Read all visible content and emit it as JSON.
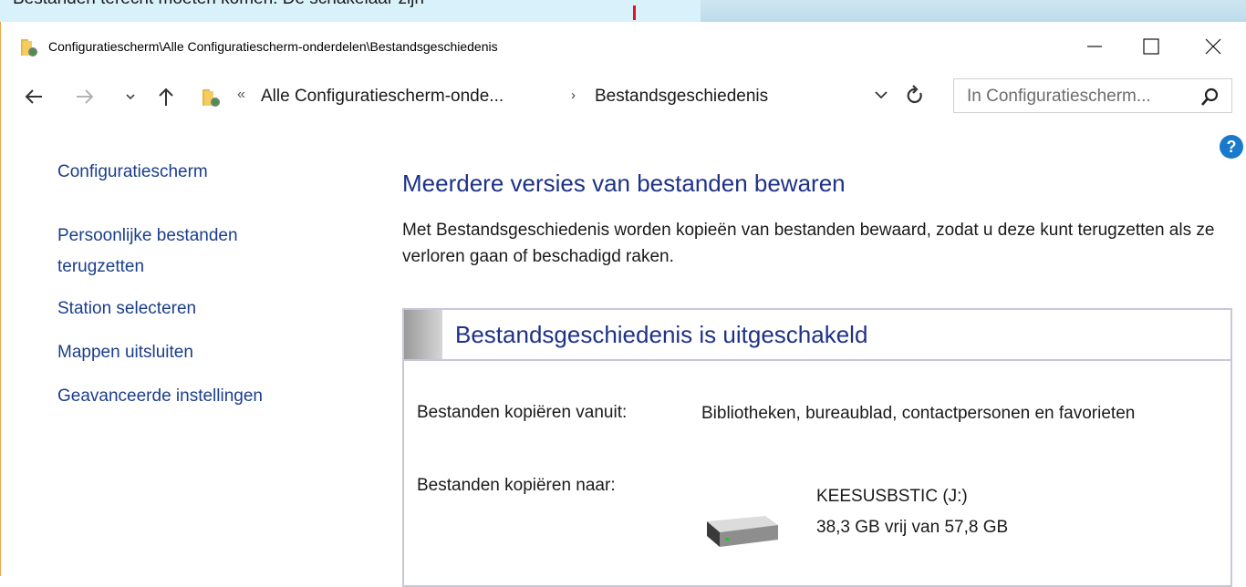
{
  "background": {
    "partial_text": "Bestanden terecht moeten komen. De schakelaar zijn"
  },
  "window": {
    "title": "Configuratiescherm\\Alle Configuratiescherm-onderdelen\\Bestandsgeschiedenis",
    "controls": {
      "minimize_icon": "minimize-icon",
      "maximize_icon": "maximize-icon",
      "close_icon": "close-icon"
    }
  },
  "navigation": {
    "back_icon": "back-arrow-icon",
    "forward_icon": "forward-arrow-icon",
    "recent_icon": "chevron-down-icon",
    "up_icon": "up-arrow-icon",
    "address": {
      "overflow_chevron": "«",
      "crumbs": [
        "Alle Configuratiescherm-onde...",
        "Bestandsgeschiedenis"
      ],
      "separator": "›"
    },
    "search_placeholder": "In Configuratiescherm..."
  },
  "help_label": "?",
  "sidebar": {
    "items": [
      {
        "label": "Configuratiescherm"
      },
      {
        "label": "Persoonlijke bestanden"
      },
      {
        "label": "terugzetten"
      },
      {
        "label": "Station selecteren"
      },
      {
        "label": "Mappen uitsluiten"
      },
      {
        "label": "Geavanceerde instellingen"
      }
    ]
  },
  "main": {
    "heading": "Meerdere versies van bestanden bewaren",
    "description": "Met Bestandsgeschiedenis worden kopieën van bestanden bewaard, zodat u deze kunt terugzetten als ze verloren gaan of beschadigd raken.",
    "status": {
      "title": "Bestandsgeschiedenis is uitgeschakeld",
      "copy_from_label": "Bestanden kopiëren vanuit:",
      "copy_from_value": "Bibliotheken, bureaublad, contactpersonen en favorieten",
      "copy_to_label": "Bestanden kopiëren naar:",
      "drive_name": "KEESUSBSTIC (J:)",
      "drive_space": "38,3 GB vrij van 57,8 GB"
    }
  },
  "colors": {
    "link": "#1a3e8c",
    "heading": "#1e3287",
    "panel_border": "#c7c7d9",
    "window_accent": "#f0a14a"
  }
}
